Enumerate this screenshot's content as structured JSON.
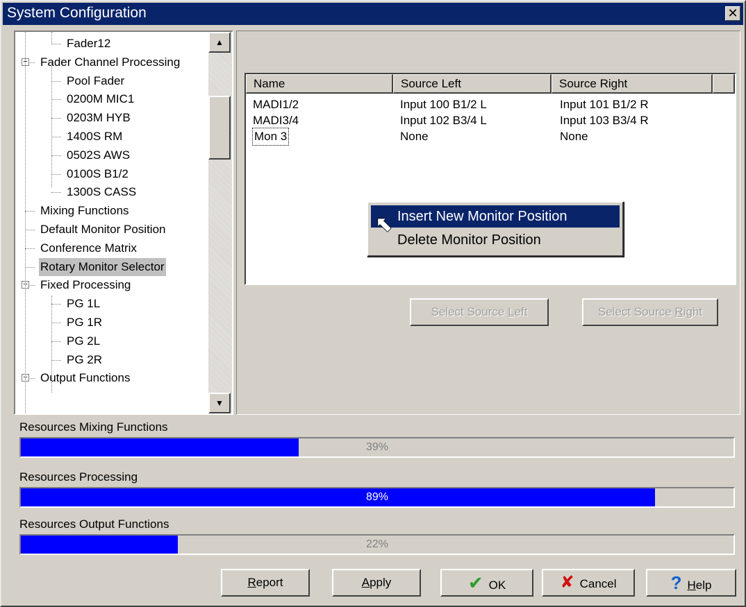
{
  "window": {
    "title": "System Configuration",
    "close_glyph": "✕"
  },
  "tree": {
    "items": [
      {
        "label": "Fader12",
        "level": 2
      },
      {
        "label": "Fader Channel Processing",
        "level": 1,
        "expander": "−"
      },
      {
        "label": "Pool Fader",
        "level": 2
      },
      {
        "label": "0200M MIC1",
        "level": 2
      },
      {
        "label": "0203M HYB",
        "level": 2
      },
      {
        "label": "1400S  RM",
        "level": 2
      },
      {
        "label": "0502S AWS",
        "level": 2
      },
      {
        "label": "0100S B1/2",
        "level": 2
      },
      {
        "label": "1300S CASS",
        "level": 2
      },
      {
        "label": "Mixing Functions",
        "level": 1
      },
      {
        "label": "Default Monitor Position",
        "level": 1
      },
      {
        "label": "Conference Matrix",
        "level": 1
      },
      {
        "label": "Rotary Monitor Selector",
        "level": 1,
        "selected": true
      },
      {
        "label": "Fixed Processing",
        "level": 1,
        "expander": "−"
      },
      {
        "label": "PG 1L",
        "level": 2
      },
      {
        "label": "PG 1R",
        "level": 2
      },
      {
        "label": "PG 2L",
        "level": 2
      },
      {
        "label": "PG 2R",
        "level": 2
      },
      {
        "label": "Output Functions",
        "level": 1,
        "expander": "−"
      }
    ],
    "scroll_up_glyph": "▲",
    "scroll_down_glyph": "▼"
  },
  "monitor_list": {
    "columns": [
      "Name",
      "Source Left",
      "Source Right"
    ],
    "rows": [
      [
        "MADI1/2",
        "Input 100 B1/2 L",
        "Input 101 B1/2 R"
      ],
      [
        "MADI3/4",
        "Input 102 B3/4 L",
        "Input 103 B3/4 R"
      ],
      [
        "Mon 3",
        "None",
        "None"
      ]
    ]
  },
  "context_menu": {
    "items": [
      "Insert New Monitor Position",
      "Delete Monitor Position"
    ],
    "cursor_glyph": "⬉"
  },
  "source_buttons": {
    "left": {
      "pre": "Select Source ",
      "key": "L",
      "post": "eft"
    },
    "right": {
      "pre": "Select Source ",
      "key": "R",
      "post": "ight"
    }
  },
  "resources": [
    {
      "label": "Resources Mixing Functions",
      "percent": 39,
      "text": "39%"
    },
    {
      "label": "Resources Processing",
      "percent": 89,
      "text": "89%"
    },
    {
      "label": "Resources Output Functions",
      "percent": 22,
      "text": "22%"
    }
  ],
  "buttons": {
    "report": {
      "key": "R",
      "rest": "eport"
    },
    "apply": {
      "key": "A",
      "rest": "pply"
    },
    "ok": {
      "icon": "✔",
      "label": "OK"
    },
    "cancel": {
      "icon": "✘",
      "label": "Cancel"
    },
    "help": {
      "icon": "?",
      "key": "H",
      "rest": "elp"
    }
  },
  "colors": {
    "progress": "#0000ff",
    "title_bar": "#0a246a",
    "ok_icon": "#2a9d2a",
    "cancel_icon": "#d01010",
    "help_icon": "#1060d0"
  }
}
